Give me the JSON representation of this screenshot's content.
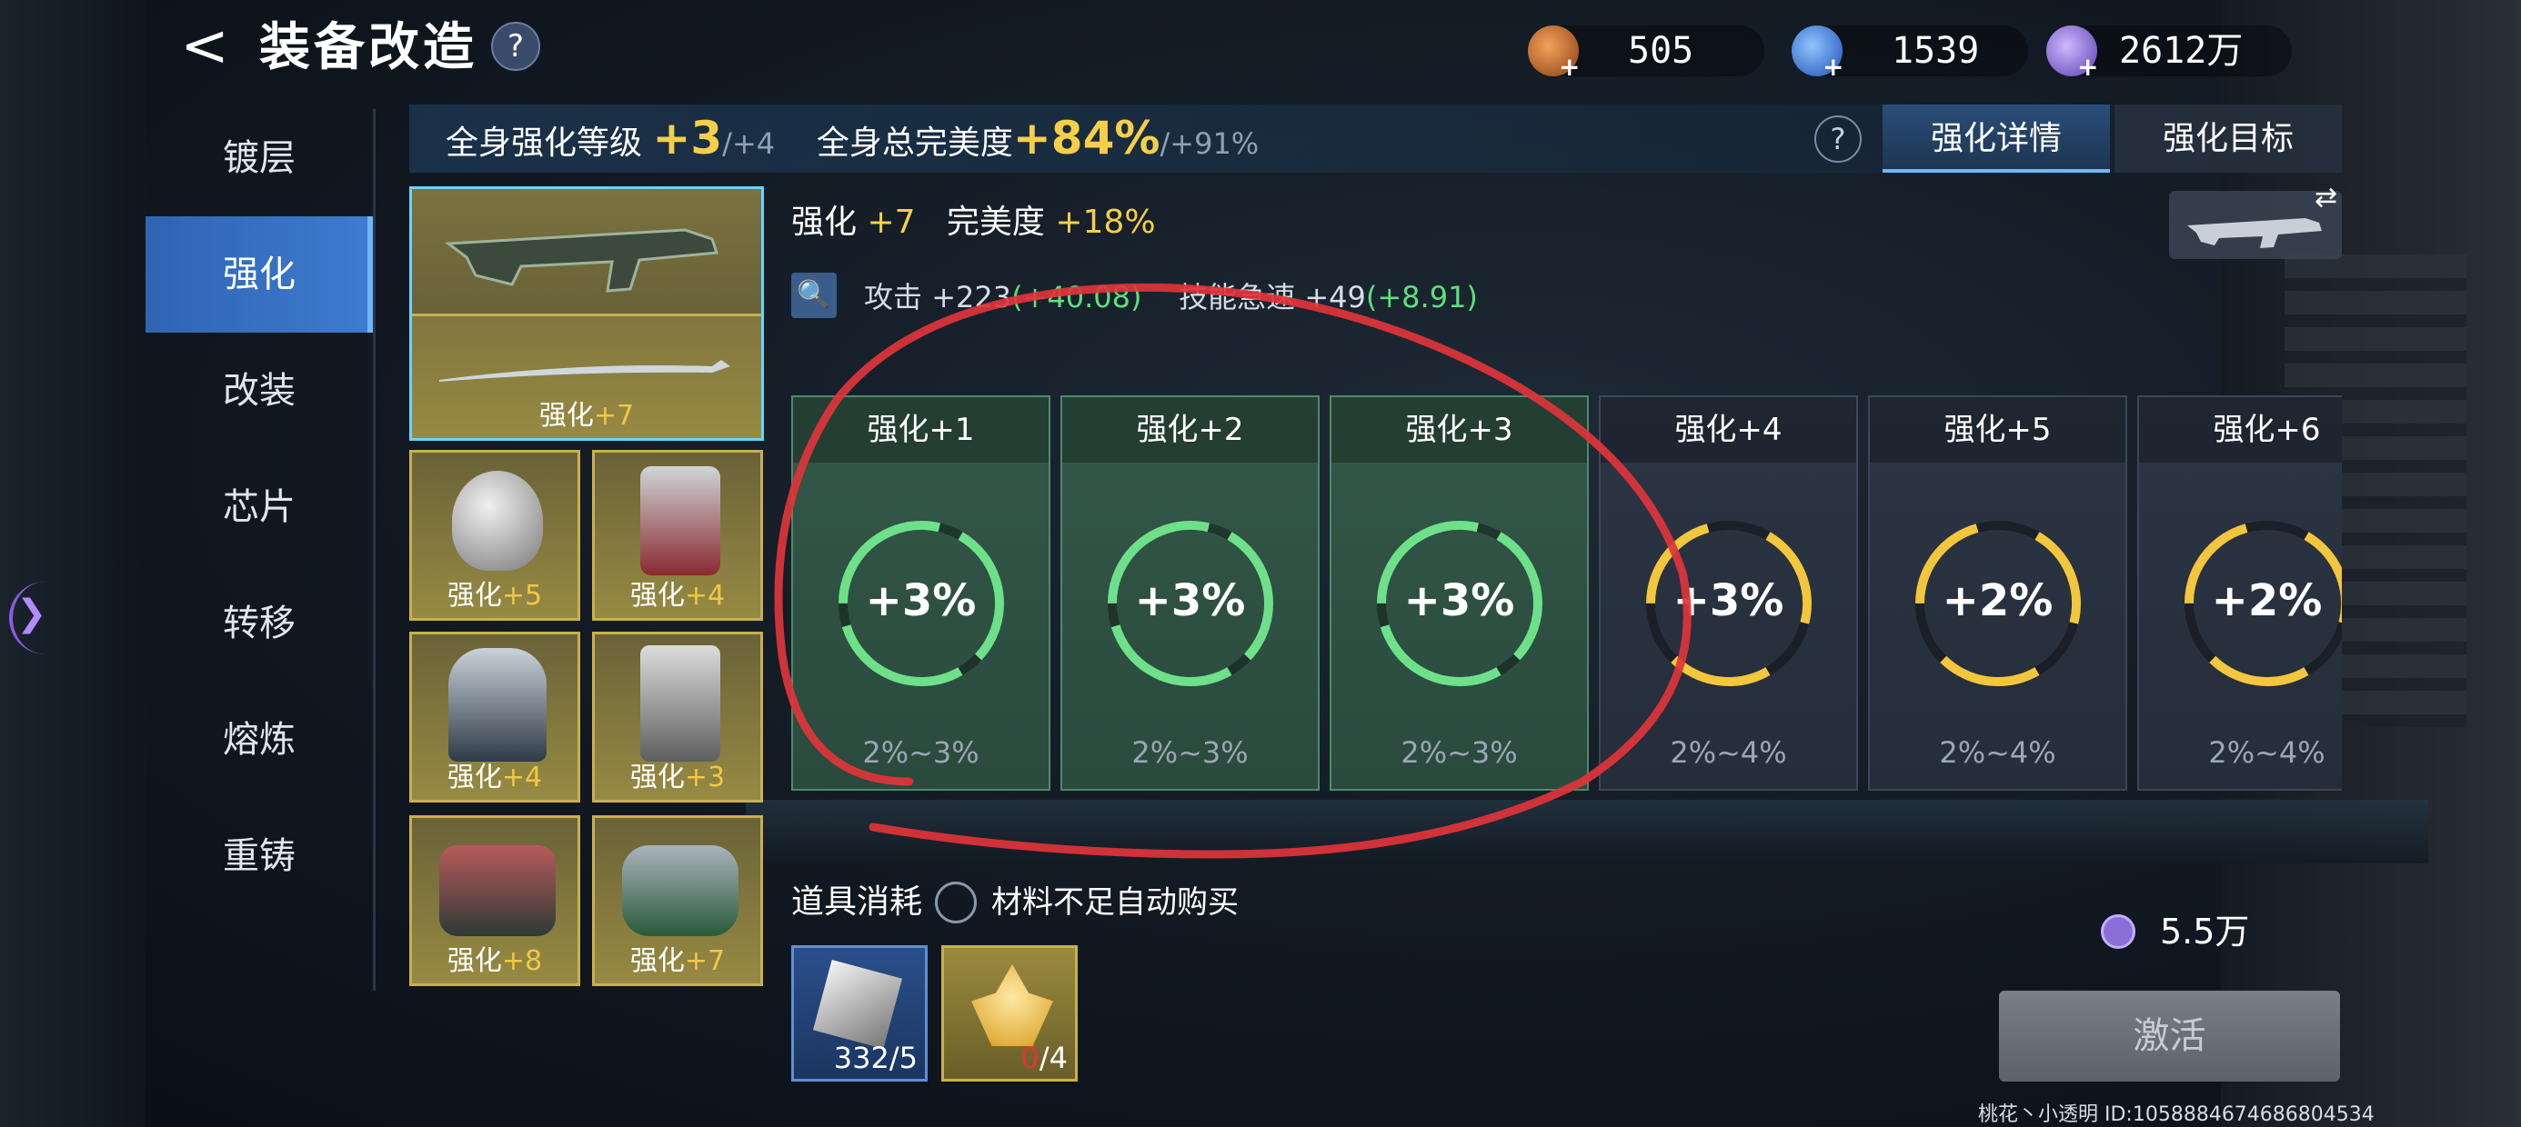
{
  "header": {
    "title": "装备改造",
    "help": "?",
    "back": "<"
  },
  "currencies": [
    {
      "name": "ore",
      "value": "505",
      "color": "#c96b2e"
    },
    {
      "name": "crystal",
      "value": "1539",
      "color": "#3f7be6"
    },
    {
      "name": "coin",
      "value": "2612万",
      "color": "#8b6fd9"
    }
  ],
  "nav": {
    "items": [
      "镀层",
      "强化",
      "改装",
      "芯片",
      "转移",
      "熔炼",
      "重铸"
    ],
    "active": 1
  },
  "summary": {
    "level_label": "全身强化等级",
    "level_value": "+3",
    "level_max": "/+4",
    "perfect_label": "全身总完美度",
    "perfect_value": "+84%",
    "perfect_max": "/+91%"
  },
  "tabs": {
    "help": "?",
    "details": "强化详情",
    "target": "强化目标"
  },
  "stats": {
    "enhance_label": "强化",
    "enhance_value": "+7",
    "perfect_label": "完美度",
    "perfect_value": "+18%",
    "attack_label": "攻击",
    "attack_value": "+223",
    "attack_bonus": "(+40.08)",
    "skill_label": "技能急速",
    "skill_value": "+49",
    "skill_bonus": "(+8.91)"
  },
  "equipment": [
    {
      "slot": "weapon-pair",
      "label": "强化",
      "level": "+7"
    },
    {
      "slot": "helmet",
      "label": "强化",
      "level": "+5"
    },
    {
      "slot": "backpack",
      "label": "强化",
      "level": "+4"
    },
    {
      "slot": "armor",
      "label": "强化",
      "level": "+4"
    },
    {
      "slot": "pants",
      "label": "强化",
      "level": "+3"
    },
    {
      "slot": "boots",
      "label": "强化",
      "level": "+8"
    },
    {
      "slot": "gloves",
      "label": "强化",
      "level": "+7"
    }
  ],
  "levels": [
    {
      "title": "强化+1",
      "pct": "+3%",
      "range": "2%~3%",
      "state": "done"
    },
    {
      "title": "强化+2",
      "pct": "+3%",
      "range": "2%~3%",
      "state": "done"
    },
    {
      "title": "强化+3",
      "pct": "+3%",
      "range": "2%~3%",
      "state": "done"
    },
    {
      "title": "强化+4",
      "pct": "+3%",
      "range": "2%~4%",
      "state": "todo"
    },
    {
      "title": "强化+5",
      "pct": "+2%",
      "range": "2%~4%",
      "state": "todo"
    },
    {
      "title": "强化+6",
      "pct": "+2%",
      "range": "2%~4%",
      "state": "todo"
    }
  ],
  "colors": {
    "done_ring": "#6fe08a",
    "todo_ring": "#f2c63d",
    "accent_gold": "#f5cf4a",
    "annotation": "#e0343a"
  },
  "consumption": {
    "label": "道具消耗",
    "auto_buy": "材料不足自动购买",
    "items": [
      {
        "name": "metal-cube",
        "count_have": "332",
        "count_need": "/5"
      },
      {
        "name": "gold-crystal",
        "count_have": "0",
        "count_need": "/4"
      }
    ],
    "cost": "5.5万"
  },
  "activate": "激活",
  "footer": "桃花丶小透明 ID:1058884674686804534"
}
